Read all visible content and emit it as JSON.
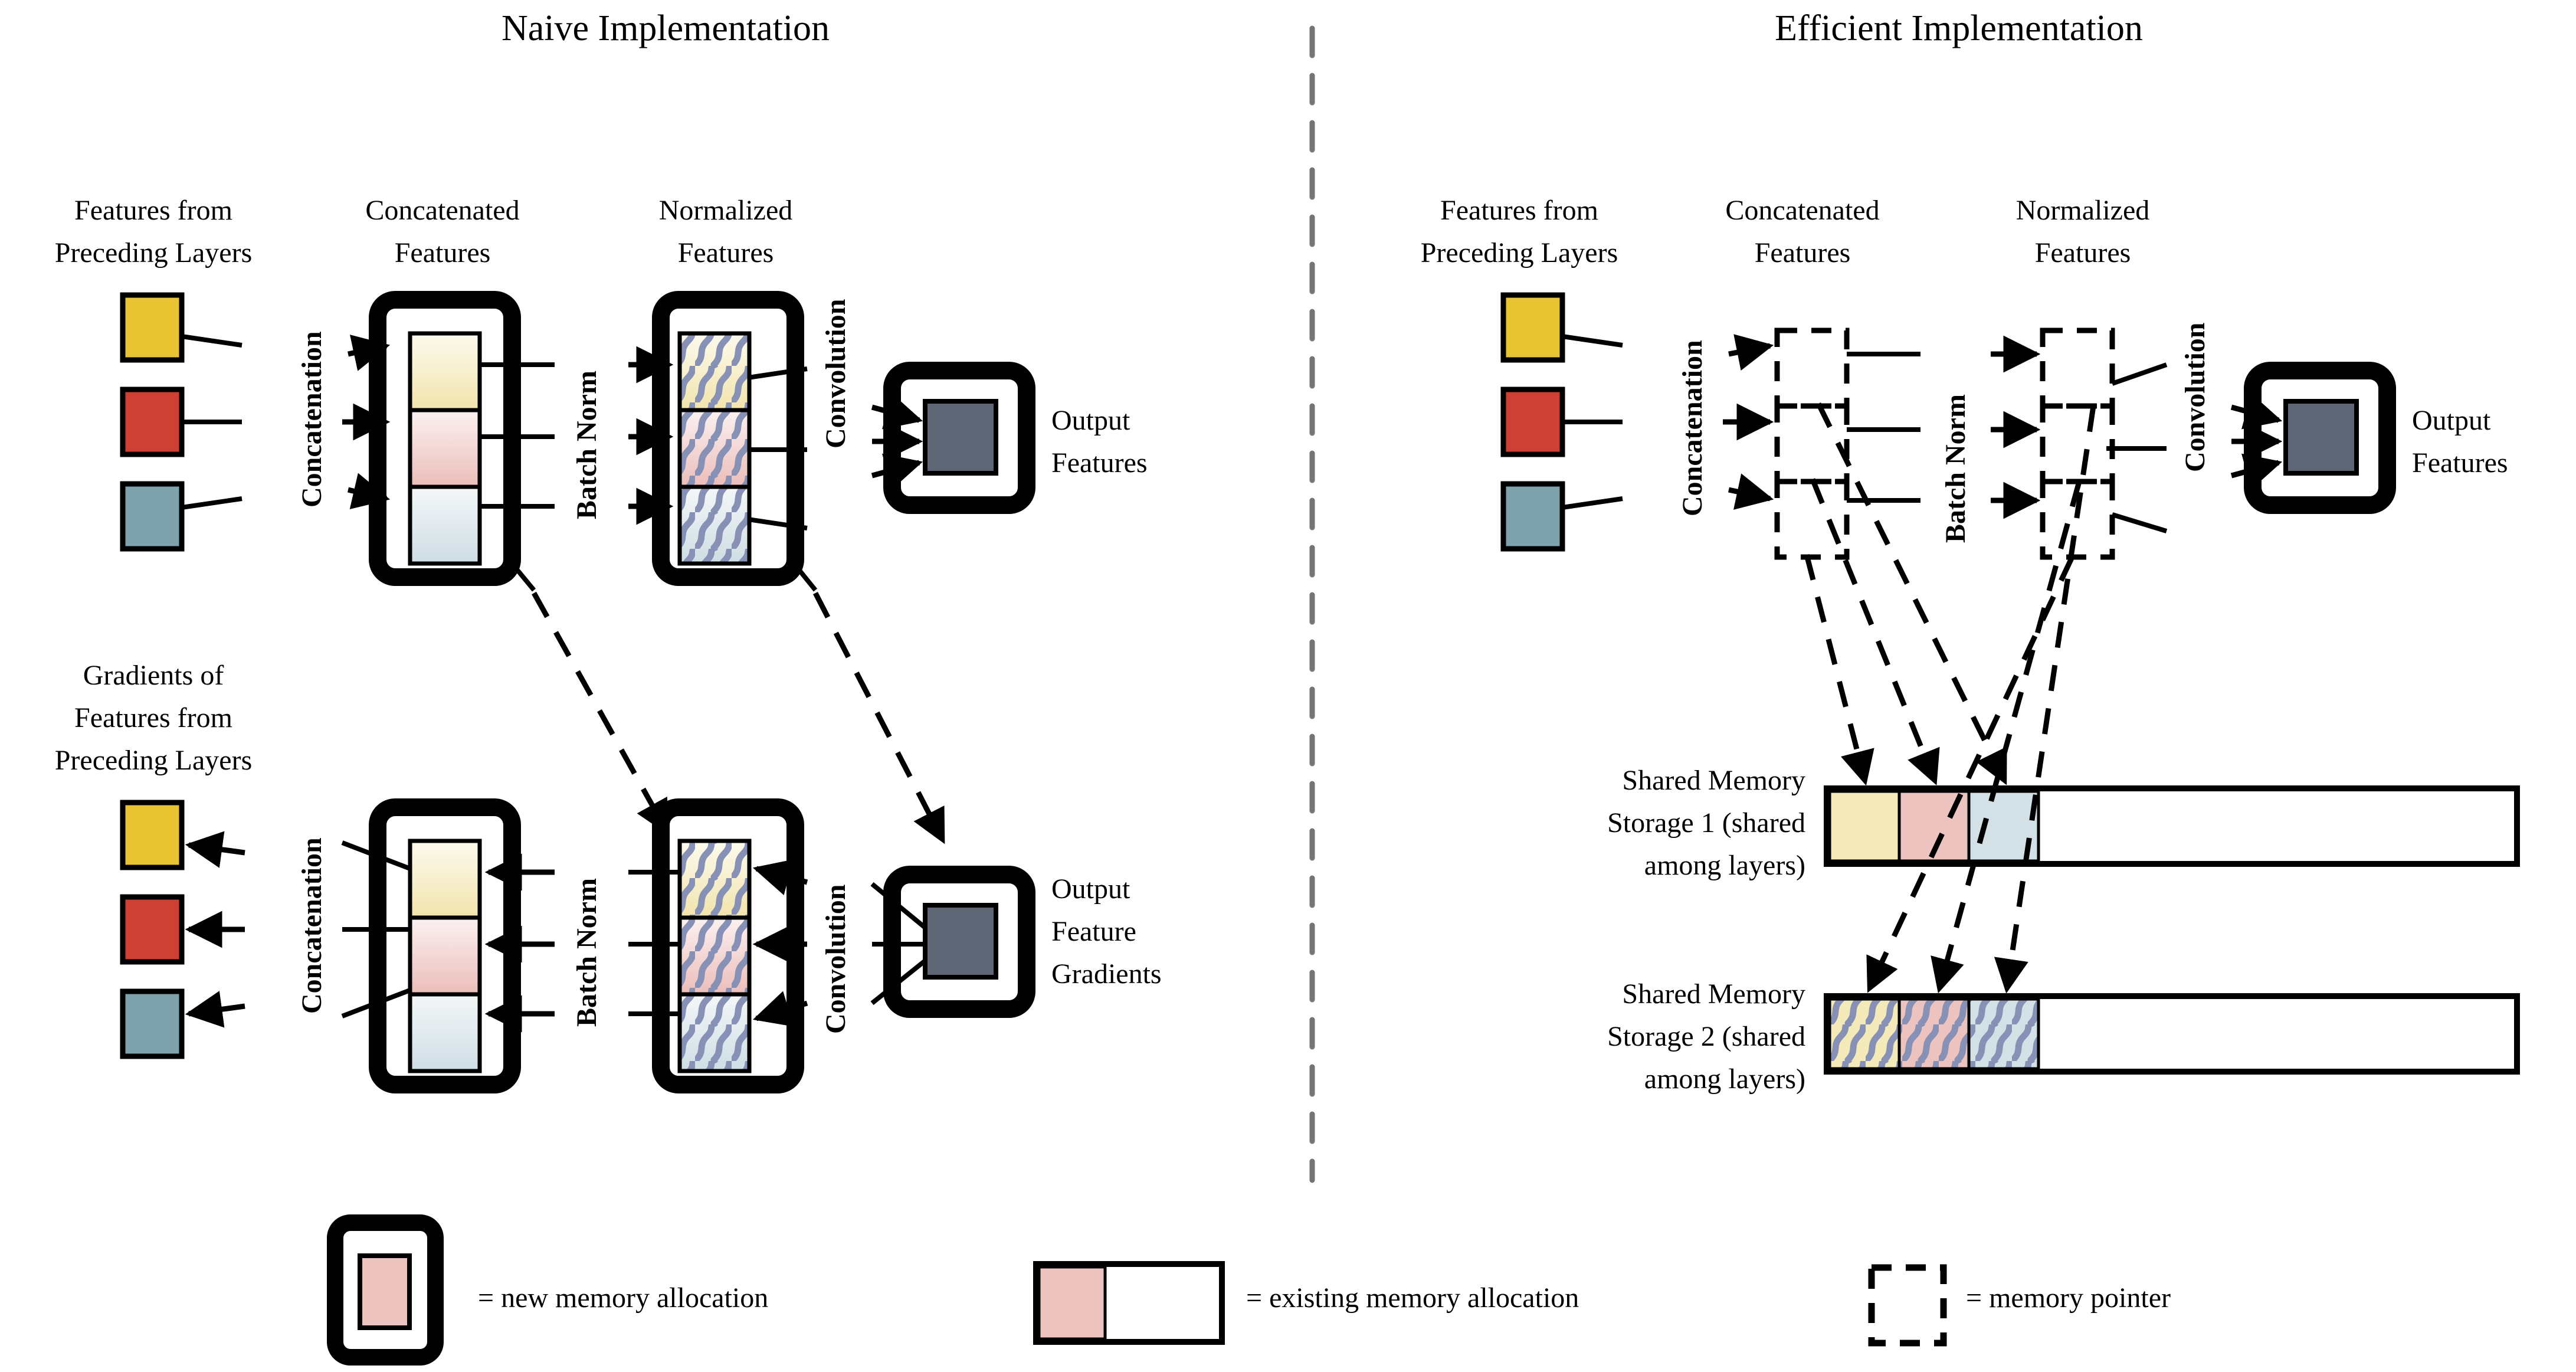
{
  "panels": {
    "left": {
      "title": "Naive Implementation",
      "forward": {
        "col_labels": [
          {
            "line1": "Features from",
            "line2": "Preceding Layers"
          },
          {
            "line1": "Concatenated",
            "line2": "Features"
          },
          {
            "line1": "Normalized",
            "line2": "Features"
          }
        ],
        "op_labels": [
          "Concatenation",
          "Batch Norm",
          "Convolution"
        ],
        "output_label": {
          "line1": "Output",
          "line2": "Features"
        },
        "input_blocks": [
          "yellow",
          "red",
          "teal"
        ],
        "concat_segments": [
          "pale-yellow",
          "pale-pink",
          "pale-blue"
        ],
        "norm_segments": [
          "pale-yellow-hatched",
          "pale-pink-hatched",
          "pale-blue-hatched"
        ]
      },
      "backward": {
        "col_label": {
          "line1": "Gradients of",
          "line2": "Features from",
          "line3": "Preceding Layers"
        },
        "op_labels": [
          "Concatenation",
          "Batch Norm",
          "Convolution"
        ],
        "output_label": {
          "line1": "Output",
          "line2": "Feature",
          "line3": "Gradients"
        },
        "input_blocks": [
          "yellow",
          "red",
          "teal"
        ],
        "concat_segments": [
          "pale-yellow",
          "pale-pink",
          "pale-blue"
        ],
        "norm_segments": [
          "pale-yellow-hatched",
          "pale-pink-hatched",
          "pale-blue-hatched"
        ]
      }
    },
    "right": {
      "title": "Efficient Implementation",
      "col_labels": [
        {
          "line1": "Features from",
          "line2": "Preceding Layers"
        },
        {
          "line1": "Concatenated",
          "line2": "Features"
        },
        {
          "line1": "Normalized",
          "line2": "Features"
        }
      ],
      "op_labels": [
        "Concatenation",
        "Batch Norm",
        "Convolution"
      ],
      "output_label": {
        "line1": "Output",
        "line2": "Features"
      },
      "input_blocks": [
        "yellow",
        "red",
        "teal"
      ],
      "storage1": {
        "line1": "Shared Memory",
        "line2": "Storage 1 (shared",
        "line3": "among layers)",
        "segments": [
          "pale-yellow",
          "pale-pink",
          "pale-blue"
        ]
      },
      "storage2": {
        "line1": "Shared Memory",
        "line2": "Storage 2 (shared",
        "line3": "among layers)",
        "segments": [
          "pale-yellow-hatched",
          "pale-pink-hatched",
          "pale-blue-hatched"
        ]
      }
    }
  },
  "legend": [
    {
      "icon": "thick-frame-with-pink-block",
      "text": "= new memory allocation"
    },
    {
      "icon": "pink-partial-fill-rect",
      "text": "= existing memory allocation"
    },
    {
      "icon": "dashed-rect",
      "text": "= memory pointer"
    }
  ],
  "colors": {
    "yellow": "#E8C432",
    "red": "#CE3F34",
    "teal": "#7FA3AC",
    "pale_yellow": "#F4E9B8",
    "pale_pink": "#EDC3C0",
    "pale_blue": "#D3E0E6",
    "hatch": "#8790B5",
    "output_gray": "#5E6575",
    "divider": "#757575",
    "stroke": "#000000"
  }
}
